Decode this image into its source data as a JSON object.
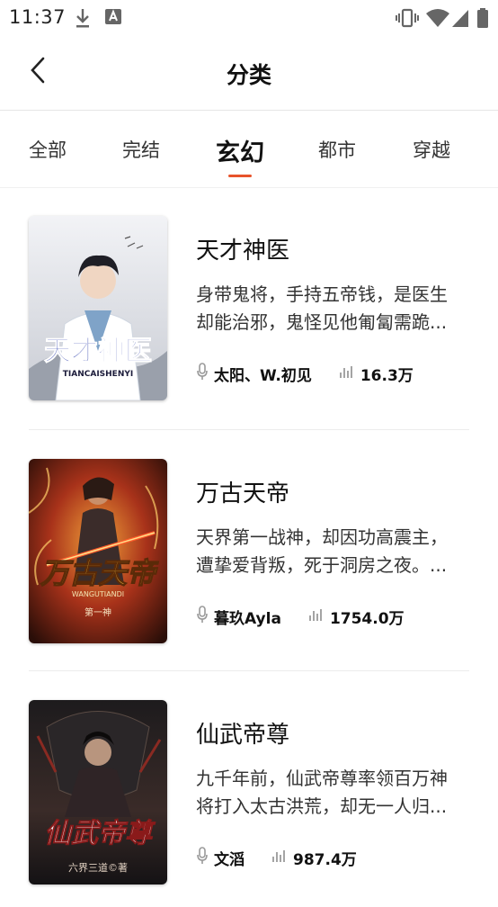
{
  "status_bar": {
    "time": "11:37"
  },
  "header": {
    "title": "分类"
  },
  "tabs": [
    {
      "label": "全部"
    },
    {
      "label": "完结"
    },
    {
      "label": "玄幻"
    },
    {
      "label": "都市"
    },
    {
      "label": "穿越"
    }
  ],
  "active_tab": "玄幻",
  "books": [
    {
      "title": "天才神医",
      "description_lines": [
        "身带鬼将，手持五帝钱，是医生",
        "却能治邪，鬼怪见他匍匐需跪..."
      ],
      "narrator": "太阳、W.初见",
      "plays": "16.3万",
      "cover_title": "天才神医",
      "cover_subtitle": "TIANCAISHENYI"
    },
    {
      "title": "万古天帝",
      "description_lines": [
        "天界第一战神，却因功高震主，",
        "遭挚爱背叛，死于洞房之夜。..."
      ],
      "narrator": "暮玖Ayla",
      "plays": "1754.0万",
      "cover_title": "万古天帝",
      "cover_subtitle": "WANGUTIANDI",
      "cover_author": "第一神"
    },
    {
      "title": "仙武帝尊",
      "description_lines": [
        "九千年前，仙武帝尊率领百万神",
        "将打入太古洪荒，却无一人归..."
      ],
      "narrator": "文滔",
      "plays": "987.4万",
      "cover_title": "仙武帝尊",
      "cover_author": "六界三道©著"
    }
  ],
  "colors": {
    "accent": "#e8532b",
    "text": "#111111",
    "meta_icon": "#9a9a9a"
  }
}
